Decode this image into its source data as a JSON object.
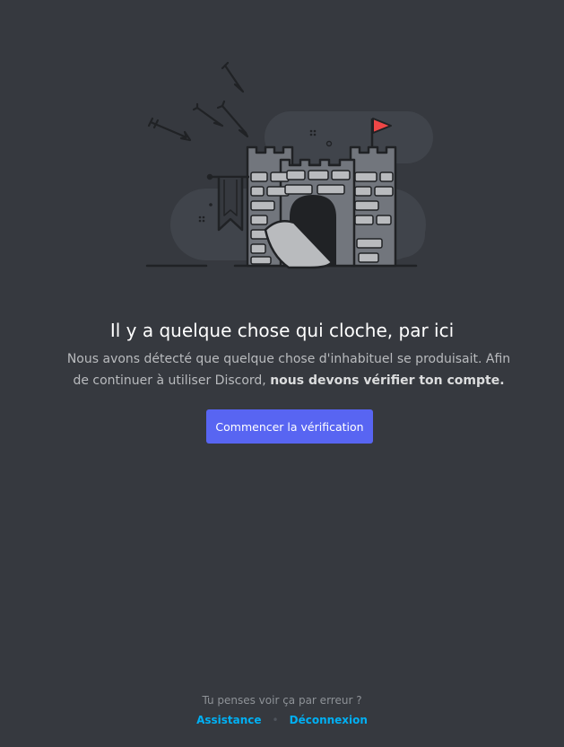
{
  "page": {
    "title": "Il y a quelque chose qui cloche, par ici",
    "description_text": "Nous avons détecté que quelque chose d'inhabituel se produisait. Afin de continuer à utiliser Discord,",
    "description_bold": "nous devons vérifier ton compte.",
    "button_label": "Commencer la vérification"
  },
  "footer": {
    "question": "Tu penses voir ça par erreur ?",
    "assistance_label": "Assistance",
    "separator": "•",
    "logout_label": "Déconnexion"
  },
  "colors": {
    "background": "#36393f",
    "button": "#5865f2",
    "link": "#00b0f4",
    "flag": "#f04747"
  },
  "illustration": {
    "icon": "castle-under-siege-illustration"
  }
}
